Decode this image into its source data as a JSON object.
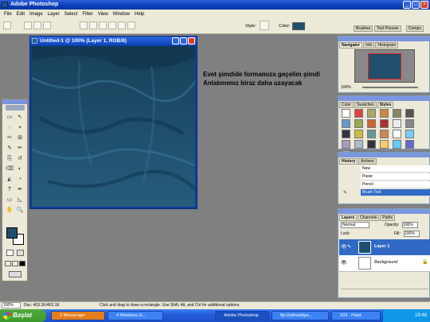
{
  "app": {
    "title": "Adobe Photoshop"
  },
  "menu": [
    "File",
    "Edit",
    "Image",
    "Layer",
    "Select",
    "Filter",
    "View",
    "Window",
    "Help"
  ],
  "options": {
    "style_label": "Style:",
    "color_label": "Color:",
    "color_swatch": "#1f4f6d",
    "tabs": [
      "Brushes",
      "Tool Presets",
      "Comps"
    ]
  },
  "document": {
    "title": "Untitled-1 @ 100% (Layer 1, RGB/8)"
  },
  "chat_text": "Evet şimdide formamıza geçelim şimdi Anlatımımız biraz daha uzayacak",
  "navigator": {
    "tabs": [
      "Navigator",
      "Info",
      "Histogram"
    ],
    "zoom": "100%"
  },
  "styles_panel": {
    "tabs": [
      "Color",
      "Swatches",
      "Styles"
    ]
  },
  "history": {
    "tabs": [
      "History",
      "Actions"
    ],
    "items": [
      "New",
      "Paste",
      "Pencil",
      "Brush Tool"
    ]
  },
  "layers": {
    "tabs": [
      "Layers",
      "Channels",
      "Paths"
    ],
    "blend": "Normal",
    "opacity_label": "Opacity:",
    "opacity": "100%",
    "lock_label": "Lock:",
    "fill_label": "Fill:",
    "fill": "100%",
    "items": [
      {
        "name": "Layer 1"
      },
      {
        "name": "Background"
      }
    ]
  },
  "statusbar": {
    "zoom": "100%",
    "doc": "Doc: 403.1K/403.1K",
    "hint": "Click and drag to draw a rectangle. Use Shift, Alt, and Ctrl for additional options."
  },
  "taskbar": {
    "start": "Başlat",
    "items": [
      "2 Messenger",
      "4 Windows G...",
      "Adobe Photoshop",
      "ftp://ydmobilya...",
      "103 - Paint"
    ],
    "lang": "TR",
    "clock": "19:48"
  },
  "colors": {
    "foreground": "#1f4f6d",
    "background": "#ffffff",
    "accent": "#0a3fb8"
  }
}
